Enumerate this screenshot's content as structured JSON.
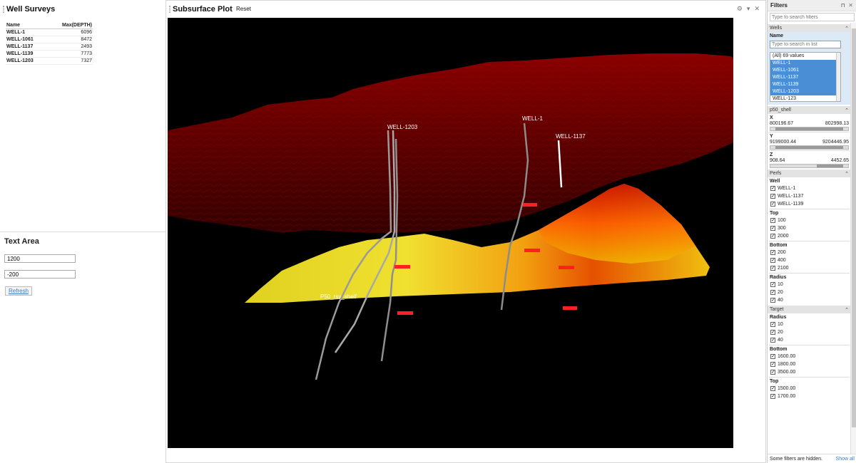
{
  "well_surveys": {
    "title": "Well Surveys",
    "columns": [
      "Name",
      "Max(DEPTH)"
    ],
    "rows": [
      {
        "name": "WELL-1",
        "depth": "6096"
      },
      {
        "name": "WELL-1061",
        "depth": "8472"
      },
      {
        "name": "WELL-1137",
        "depth": "2493"
      },
      {
        "name": "WELL-1139",
        "depth": "7773"
      },
      {
        "name": "WELL-1203",
        "depth": "7327"
      }
    ]
  },
  "text_area": {
    "title": "Text Area",
    "input1": "1200",
    "input2": "-200",
    "refresh_label": "Refresh"
  },
  "plot": {
    "title": "Subsurface Plot",
    "reset_label": "Reset",
    "labels": {
      "overlap": "WELL-1203",
      "well1": "WELL-1",
      "well1137": "WELL-1137",
      "surface": "P50_rsv_shelf"
    }
  },
  "filters": {
    "title": "Filters",
    "search_placeholder": "Type to search filters",
    "wells": {
      "title": "Wells",
      "name_label": "Name",
      "list_placeholder": "Type to search in list",
      "items": [
        {
          "label": "(All) 69 values",
          "selected": false
        },
        {
          "label": "WELL-1",
          "selected": true
        },
        {
          "label": "WELL-1061",
          "selected": true
        },
        {
          "label": "WELL-1137",
          "selected": true
        },
        {
          "label": "WELL-1139",
          "selected": true
        },
        {
          "label": "WELL-1203",
          "selected": true
        },
        {
          "label": "WELL-123",
          "selected": false
        }
      ]
    },
    "p50_shell": {
      "title": "p50_shell",
      "x": {
        "label": "X",
        "min": "800196.67",
        "max": "802998.13"
      },
      "y": {
        "label": "Y",
        "min": "9199000.44",
        "max": "9204446.95"
      },
      "z": {
        "label": "Z",
        "min": "908.64",
        "max": "4452.65"
      }
    },
    "perfs": {
      "title": "Perfs",
      "well_label": "Well",
      "wells": [
        "WELL-1",
        "WELL-1137",
        "WELL-1139"
      ],
      "top_label": "Top",
      "top": [
        "100",
        "300",
        "2000"
      ],
      "bottom_label": "Bottom",
      "bottom": [
        "200",
        "400",
        "2100"
      ],
      "radius_label": "Radius",
      "radius": [
        "10",
        "20",
        "40"
      ]
    },
    "target": {
      "title": "Target",
      "radius_label": "Radius",
      "radius": [
        "10",
        "20",
        "40"
      ],
      "bottom_label": "Bottom",
      "bottom": [
        "1600.00",
        "1800.00",
        "3500.00"
      ],
      "top_label": "Top",
      "top": [
        "1500.00",
        "1700.00"
      ]
    },
    "footer_text": "Some filters are hidden.",
    "show_all_label": "Show all"
  }
}
